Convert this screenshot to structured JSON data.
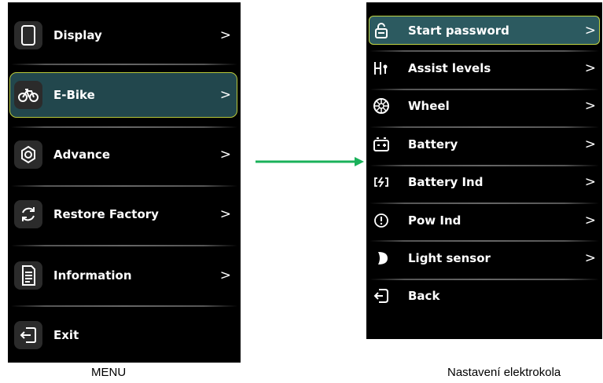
{
  "left_menu": {
    "items": [
      {
        "label": "Display",
        "icon": "phone-icon",
        "chevron": ">"
      },
      {
        "label": "E-Bike",
        "icon": "bicycle-icon",
        "chevron": ">",
        "selected": true
      },
      {
        "label": "Advance",
        "icon": "gear-icon",
        "chevron": ">"
      },
      {
        "label": "Restore Factory",
        "icon": "restore-icon",
        "chevron": ">"
      },
      {
        "label": "Information",
        "icon": "document-icon",
        "chevron": ">"
      },
      {
        "label": "Exit",
        "icon": "exit-icon"
      }
    ],
    "caption": "MENU"
  },
  "right_menu": {
    "items": [
      {
        "label": "Start password",
        "icon": "lock-icon",
        "chevron": ">",
        "selected": true
      },
      {
        "label": "Assist levels",
        "icon": "assist-levels-icon",
        "chevron": ">"
      },
      {
        "label": "Wheel",
        "icon": "wheel-icon",
        "chevron": ">"
      },
      {
        "label": "Battery",
        "icon": "battery-icon",
        "chevron": ">"
      },
      {
        "label": "Battery Ind",
        "icon": "battery-indicator-icon",
        "chevron": ">"
      },
      {
        "label": "Pow Ind",
        "icon": "power-indicator-icon",
        "chevron": ">"
      },
      {
        "label": "Light sensor",
        "icon": "light-sensor-icon",
        "chevron": ">"
      },
      {
        "label": "Back",
        "icon": "back-icon"
      }
    ],
    "caption": "Nastavení elektrokola"
  },
  "colors": {
    "screen_bg": "#000000",
    "selection_fill": "#22474d",
    "selection_border": "#b9c93a",
    "arrow": "#1ab15a",
    "text": "#ffffff"
  }
}
